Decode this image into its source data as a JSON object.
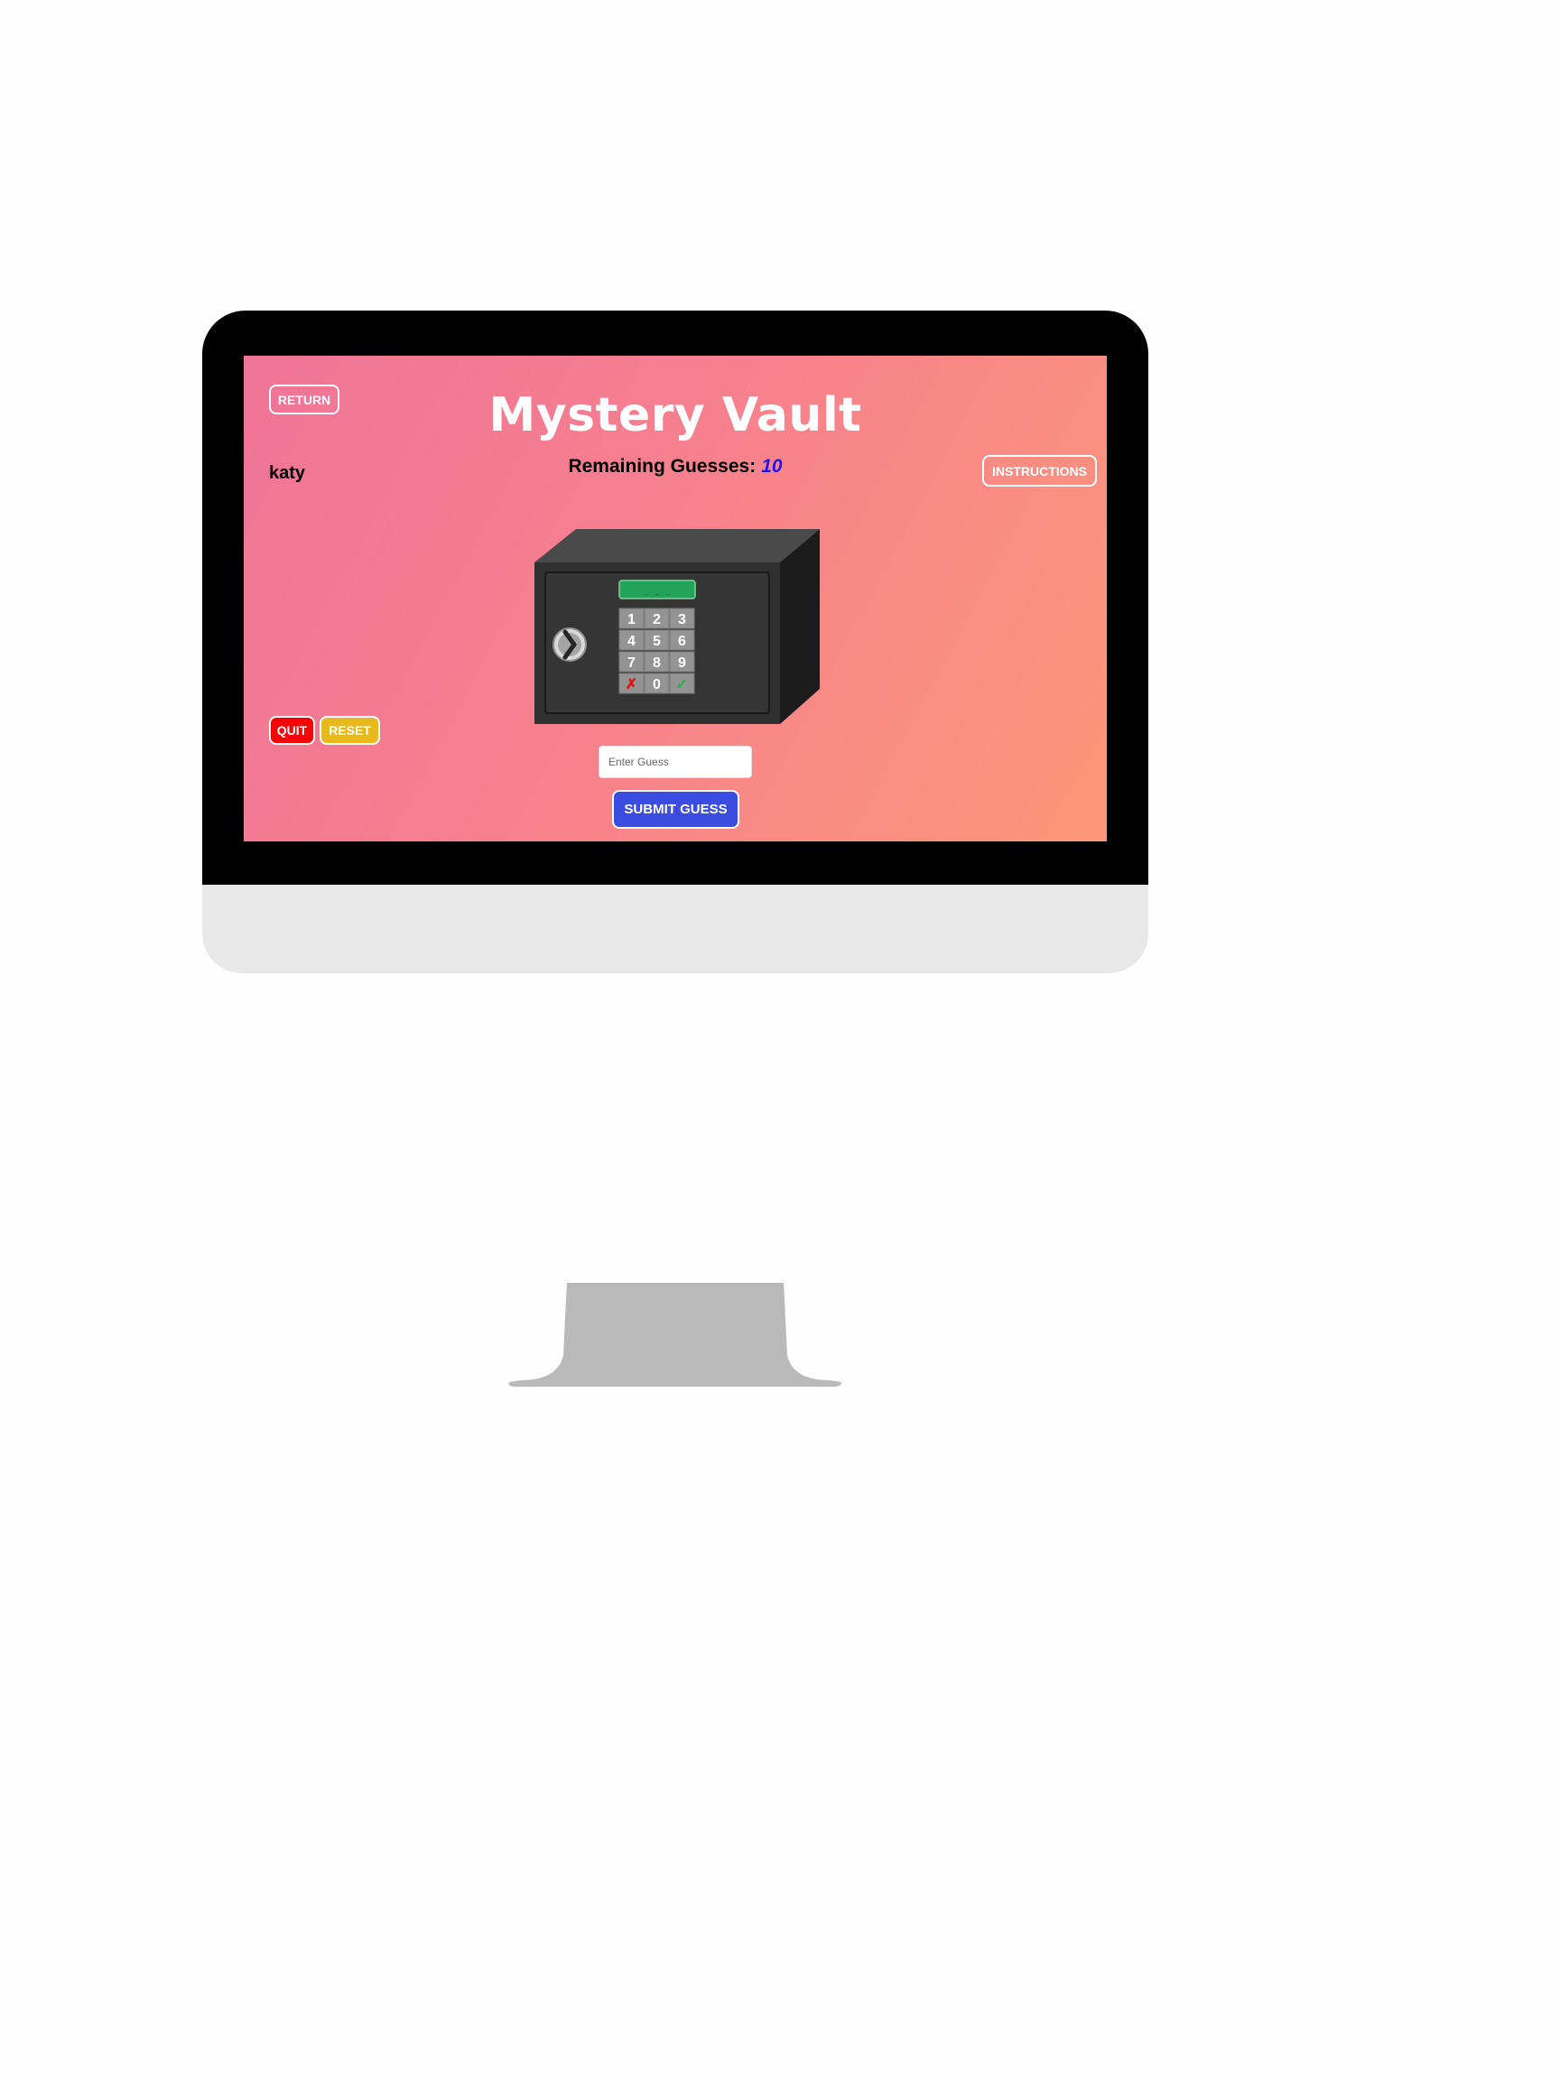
{
  "app": {
    "title": "Mystery Vault",
    "remaining_label": "Remaining Guesses:",
    "remaining_count": "10",
    "username": "katy"
  },
  "nav": {
    "return_label": "RETURN",
    "instructions_label": "INSTRUCTIONS"
  },
  "controls": {
    "quit_label": "QUIT",
    "reset_label": "RESET"
  },
  "vault": {
    "display_text": "_ _ _",
    "keypad": {
      "row1": [
        "1",
        "2",
        "3"
      ],
      "row2": [
        "4",
        "5",
        "6"
      ],
      "row3": [
        "7",
        "8",
        "9"
      ],
      "row4": [
        "✗",
        "0",
        "✓"
      ]
    }
  },
  "guess_form": {
    "placeholder": "Enter Guess",
    "submit_label": "SUBMIT GUESS"
  },
  "colors": {
    "bg_gradient_start": "#f07398",
    "bg_gradient_end": "#fc9778",
    "remaining_count": "#2214f2",
    "quit": "#f60404",
    "reset": "#e7b91e",
    "submit": "#3a4de0",
    "vault_display": "#22a35a"
  }
}
